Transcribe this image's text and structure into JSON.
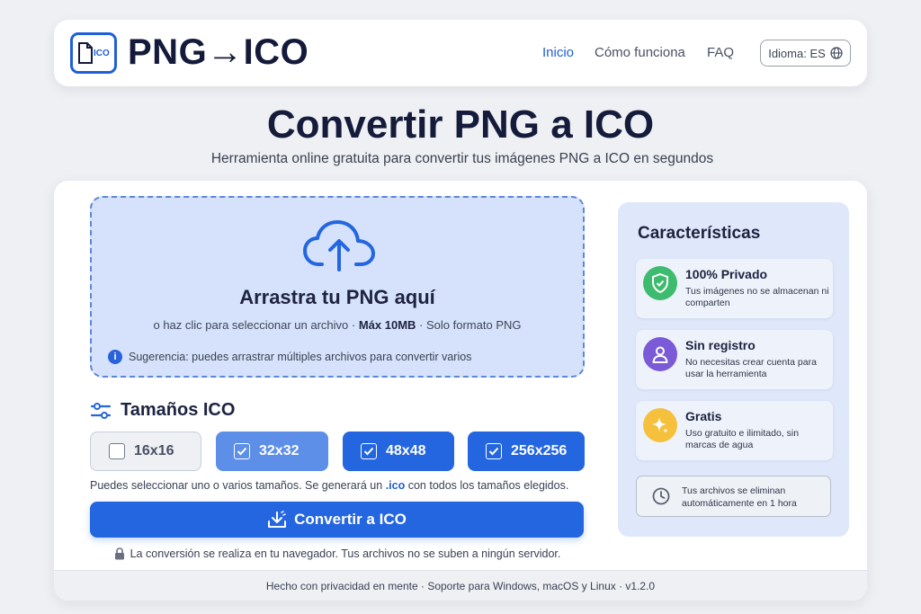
{
  "header": {
    "logo_badge": "ICO",
    "brand": "PNG→ICO",
    "nav": [
      {
        "label": "Inicio",
        "active": true
      },
      {
        "label": "Cómo funciona",
        "active": false
      },
      {
        "label": "FAQ",
        "active": false
      }
    ],
    "language_label": "Idioma: ES"
  },
  "hero": {
    "title": "Convertir PNG a ICO",
    "subtitle": "Herramienta online gratuita para convertir tus imágenes PNG a ICO en segundos"
  },
  "dropzone": {
    "title": "Arrastra tu PNG aquí",
    "sub_click": "o haz clic para seleccionar un archivo",
    "sub_max": "Máx 10MB",
    "sub_format": "Solo formato PNG",
    "hint": "Sugerencia: puedes arrastrar múltiples archivos para convertir varios"
  },
  "sizes": {
    "title": "Tamaños ICO",
    "options": [
      {
        "label": "16x16",
        "checked": false
      },
      {
        "label": "32x32",
        "checked": true
      },
      {
        "label": "48x48",
        "checked": true
      },
      {
        "label": "256x256",
        "checked": true
      }
    ],
    "note_before": "Puedes seleccionar uno o varios tamaños. Se generará un",
    "note_ext": ".ico",
    "note_after": "con todos los tamaños elegidos."
  },
  "convert_label": "Convertir a ICO",
  "privacy_note": "La conversión se realiza en tu navegador. Tus archivos no se suben a ningún servidor.",
  "features": {
    "title": "Características",
    "items": [
      {
        "title": "100% Privado",
        "desc": "Tus imágenes no se almacenan ni comparten",
        "color": "#3dbb6e",
        "icon": "shield-check-icon"
      },
      {
        "title": "Sin registro",
        "desc": "No necesitas crear cuenta para usar la herramienta",
        "color": "#7a5ad6",
        "icon": "user-icon"
      },
      {
        "title": "Gratis",
        "desc": "Uso gratuito e ilimitado, sin marcas de agua",
        "color": "#f5c13d",
        "icon": "sparkle-icon"
      }
    ],
    "note": "Tus archivos se eliminan automáticamente en 1 hora"
  },
  "footer": "Hecho con privacidad en mente · Soporte para Windows, macOS y Linux · v1.2.0",
  "colors": {
    "accent": "#2466df",
    "brand_dark": "#141a3a",
    "dropzone_bg": "#d6e2fb"
  }
}
